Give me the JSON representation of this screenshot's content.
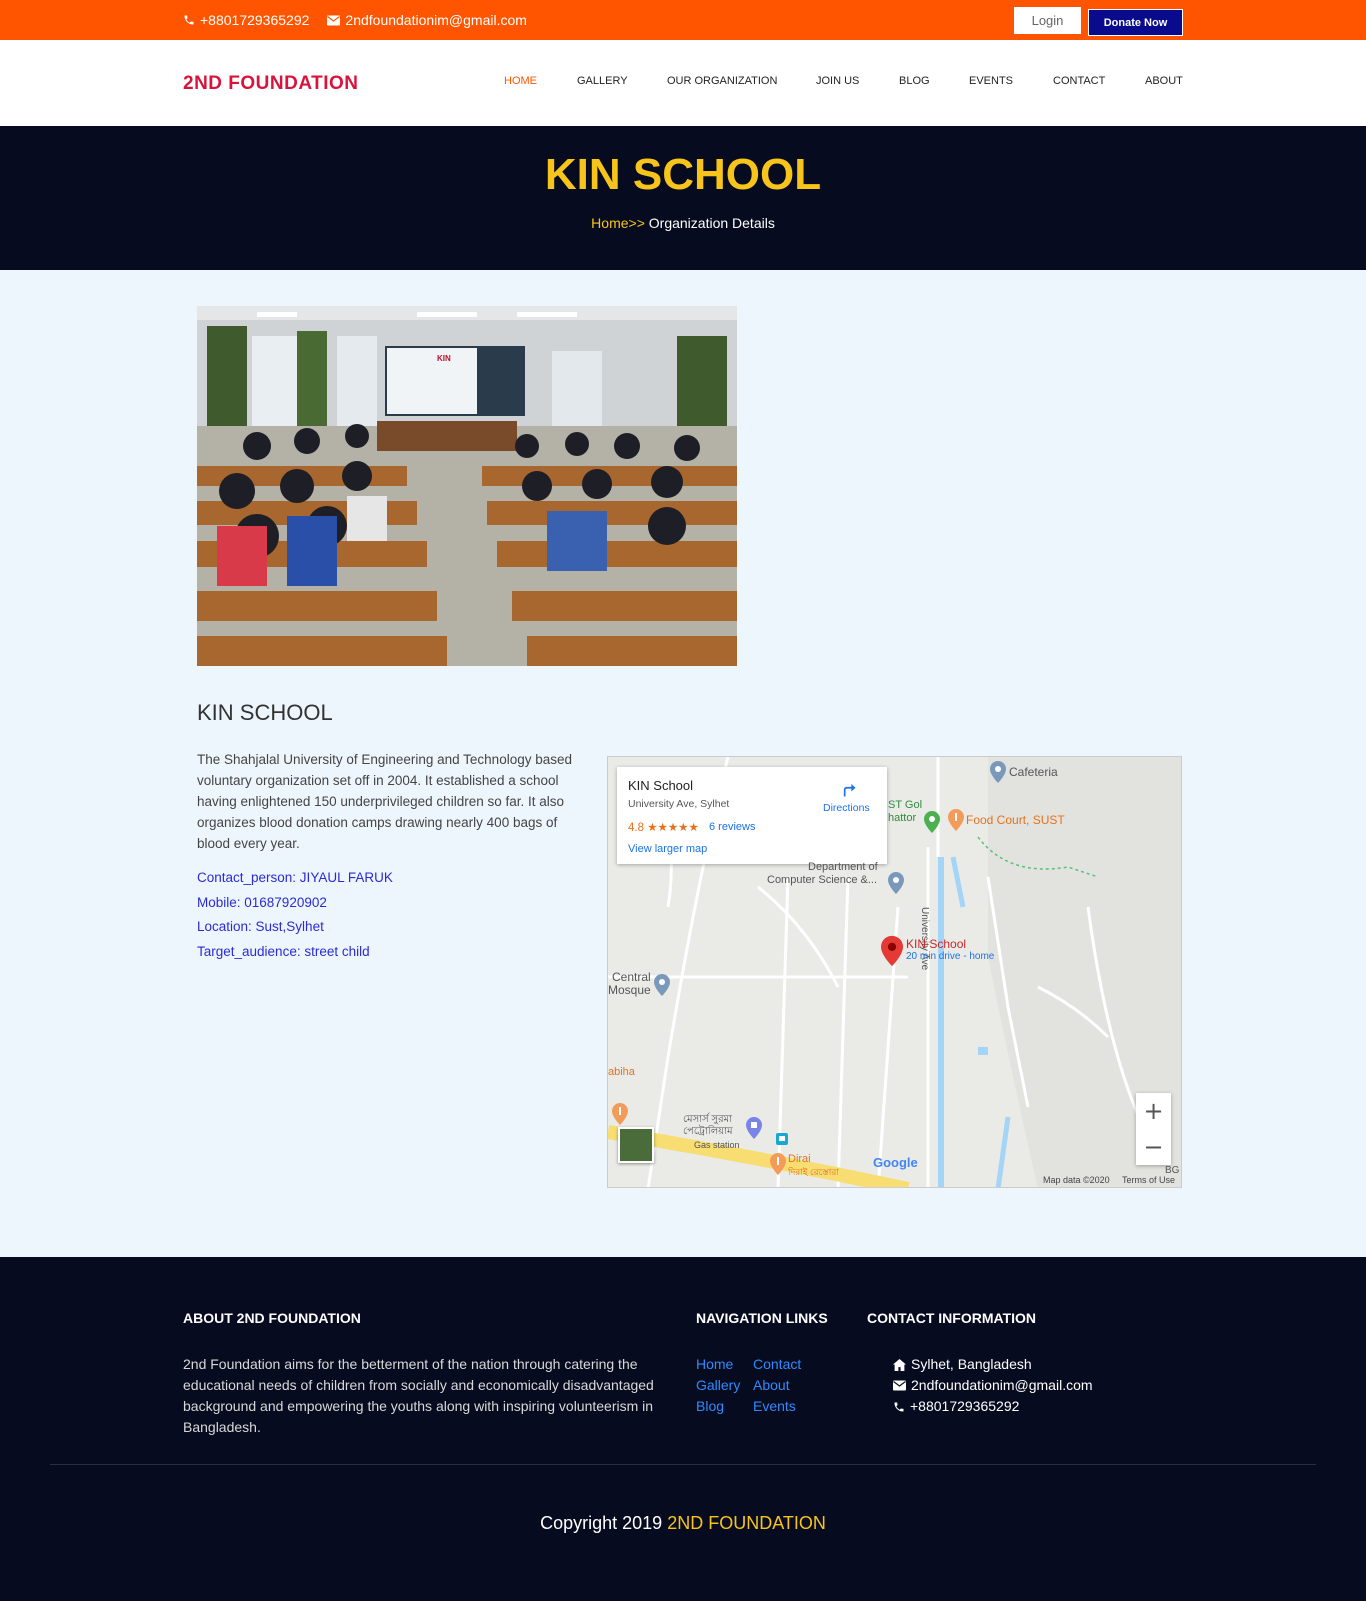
{
  "topbar": {
    "phone": "+8801729365292",
    "email": "2ndfoundationim@gmail.com",
    "login_label": "Login",
    "donate_label": "Donate Now"
  },
  "header": {
    "logo": "2ND FOUNDATION",
    "nav": [
      {
        "label": "HOME",
        "active": true
      },
      {
        "label": "GALLERY",
        "active": false
      },
      {
        "label": "OUR ORGANIZATION",
        "active": false
      },
      {
        "label": "JOIN US",
        "active": false
      },
      {
        "label": "BLOG",
        "active": false
      },
      {
        "label": "EVENTS",
        "active": false
      },
      {
        "label": "CONTACT",
        "active": false
      },
      {
        "label": "ABOUT",
        "active": false
      }
    ]
  },
  "hero": {
    "title": "KIN SCHOOL",
    "breadcrumb_home": "Home>>",
    "breadcrumb_current": "Organization Details"
  },
  "main": {
    "section_title": "KIN SCHOOL",
    "description": "The Shahjalal University of Engineering and Technology based voluntary organization set off in 2004. It established a school having enlightened 150 underprivileged children so far. It also organizes blood donation camps drawing nearly 400 bags of blood every year.",
    "contact_person": "Contact_person: JIYAUL FARUK",
    "mobile": "Mobile: 01687920902",
    "location": "Location: Sust,Sylhet",
    "target_audience": "Target_audience: street child",
    "photo_banner": "KIN"
  },
  "map": {
    "place_name": "KIN School",
    "address": "University Ave, Sylhet",
    "rating": "4.8",
    "stars": "★★★★★",
    "reviews": "6 reviews",
    "larger_map": "View larger map",
    "directions": "Directions",
    "labels": {
      "cafeteria": "Cafeteria",
      "food_court": "Food Court, SUST",
      "st_gol": "ST Gol",
      "chattor": "hattor",
      "dept_cs_1": "Department of",
      "dept_cs_2": "Computer Science &...",
      "university_ave": "University Ave",
      "pin_name": "KIN School",
      "pin_sub": "20 min drive - home",
      "mosque_1": "Central",
      "mosque_2": "Mosque",
      "abiha": "abiha",
      "gas_station_bn": "মেসার্স সুরমা পেট্রোলিয়াম",
      "gas_station": "Gas station",
      "dirai": "Dirai",
      "dirai_bn": "দিরাই রেস্তোরা",
      "bg": "BG"
    },
    "google": "Google",
    "map_data": "Map data ©2020",
    "terms": "Terms of Use",
    "zoom_in": "+",
    "zoom_out": "−"
  },
  "footer": {
    "about_heading": "ABOUT 2ND FOUNDATION",
    "about_text": "2nd Foundation aims for the betterment of the nation through catering the educational needs of children from socially and economically disadvantaged background and empowering the youths along with inspiring volunteerism in Bangladesh.",
    "nav_heading": "NAVIGATION LINKS",
    "links": [
      "Home",
      "Contact",
      "Gallery",
      "About",
      "Blog",
      "Events"
    ],
    "contact_heading": "CONTACT INFORMATION",
    "address": "Sylhet, Bangladesh",
    "email": "2ndfoundationim@gmail.com",
    "phone": "+8801729365292",
    "copyright_prefix": "Copyright 2019",
    "copyright_brand": "2ND FOUNDATION"
  },
  "colors": {
    "topbar": "#ff5500",
    "brand_red": "#d9143c",
    "hero_bg": "#070b1f",
    "accent_yellow": "#f7c41b",
    "donate": "#0a0a8c",
    "info_blue": "#2a2ad6"
  }
}
